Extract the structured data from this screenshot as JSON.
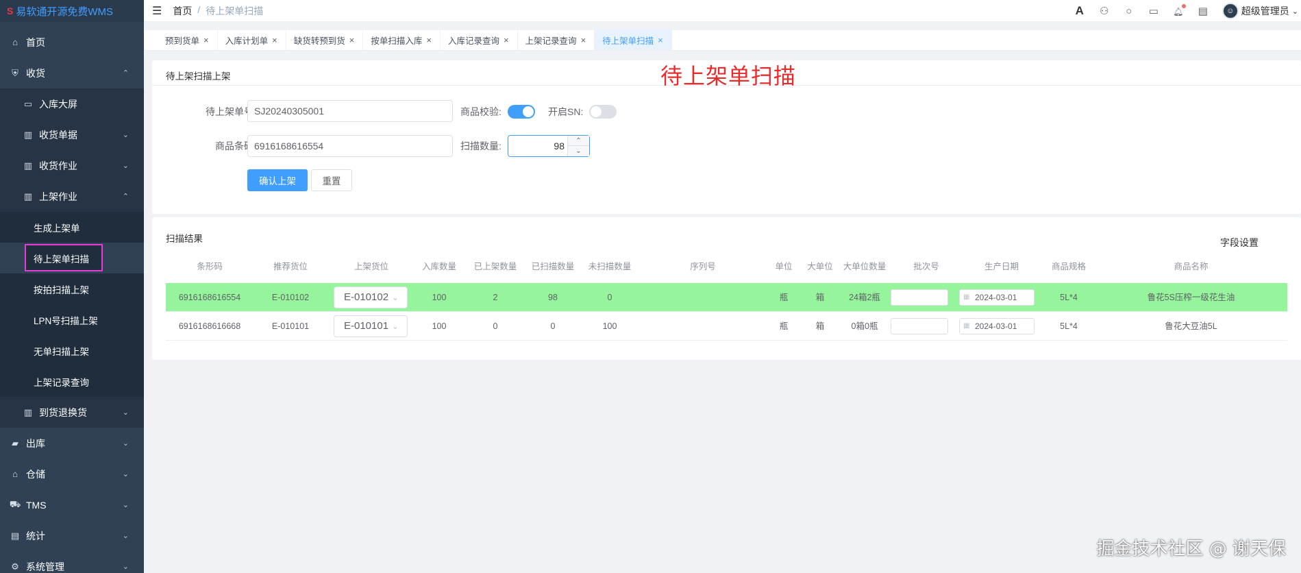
{
  "app": {
    "title": "易软通开源免费WMS",
    "logo_mark": "S"
  },
  "sidebar": {
    "items": [
      {
        "label": "首页",
        "icon": "home-icon",
        "glyph": "⌂"
      },
      {
        "label": "收货",
        "icon": "receive-icon",
        "glyph": "⛨",
        "arrow": "⌃"
      },
      {
        "label": "入库大屏",
        "icon": "monitor-icon",
        "glyph": "▭"
      },
      {
        "label": "收货单据",
        "icon": "doc-icon",
        "glyph": "▥",
        "arrow": "⌄"
      },
      {
        "label": "收货作业",
        "icon": "task-icon",
        "glyph": "▥",
        "arrow": "⌄"
      },
      {
        "label": "上架作业",
        "icon": "shelf-icon",
        "glyph": "▥",
        "arrow": "⌃"
      },
      {
        "label": "生成上架单"
      },
      {
        "label": "待上架单扫描"
      },
      {
        "label": "按拍扫描上架"
      },
      {
        "label": "LPN号扫描上架"
      },
      {
        "label": "无单扫描上架"
      },
      {
        "label": "上架记录查询"
      },
      {
        "label": "到货退换货",
        "icon": "return-icon",
        "glyph": "▥",
        "arrow": "⌄"
      },
      {
        "label": "出库",
        "icon": "outbound-icon",
        "glyph": "▰",
        "arrow": "⌄"
      },
      {
        "label": "仓储",
        "icon": "warehouse-icon",
        "glyph": "⌂",
        "arrow": "⌄"
      },
      {
        "label": "TMS",
        "icon": "truck-icon",
        "glyph": "⛟",
        "arrow": "⌄"
      },
      {
        "label": "统计",
        "icon": "stats-icon",
        "glyph": "▤",
        "arrow": "⌄"
      },
      {
        "label": "系统管理",
        "icon": "settings-icon",
        "glyph": "⚙",
        "arrow": "⌄"
      }
    ]
  },
  "header": {
    "hamburger": "☰",
    "breadcrumb": {
      "home": "首页",
      "sep": "/",
      "current": "待上架单扫描"
    },
    "icons": {
      "font": "A",
      "user": "⚇",
      "search": "○",
      "screen": "▭",
      "bell": "🔔︎",
      "doc": "▤"
    },
    "user_name": "超级管理员",
    "user_arrow": "⌄",
    "avatar_glyph": "☺"
  },
  "tabs": [
    {
      "label": "预到货单",
      "close": "×"
    },
    {
      "label": "入库计划单",
      "close": "×"
    },
    {
      "label": "缺货转预到货",
      "close": "×"
    },
    {
      "label": "按单扫描入库",
      "close": "×"
    },
    {
      "label": "入库记录查询",
      "close": "×"
    },
    {
      "label": "上架记录查询",
      "close": "×"
    },
    {
      "label": "待上架单扫描",
      "close": "×"
    }
  ],
  "form": {
    "card_title": "待上架扫描上架",
    "big_title": "待上架单扫描",
    "order_no_label": "待上架单号",
    "order_no_value": "SJ20240305001",
    "check_label": "商品校验:",
    "sn_label": "开启SN:",
    "barcode_label": "商品条码",
    "barcode_value": "6916168616554",
    "qty_label": "扫描数量:",
    "qty_value": "98",
    "step_up": "⌃",
    "step_down": "⌄",
    "confirm_label": "确认上架",
    "reset_label": "重置",
    "goods_check_on": true,
    "sn_on": false
  },
  "results": {
    "title": "扫描结果",
    "field_settings": "字段设置",
    "columns": [
      "条形码",
      "推荐货位",
      "上架货位",
      "入库数量",
      "已上架数量",
      "已扫描数量",
      "未扫描数量",
      "序列号",
      "单位",
      "大单位",
      "大单位数量",
      "批次号",
      "生产日期",
      "商品规格",
      "商品名称"
    ],
    "rows": [
      {
        "barcode": "6916168616554",
        "rec_loc": "E-010102",
        "shelf_loc": "E-010102",
        "in_qty": "100",
        "shelved": "2",
        "scanned": "98",
        "unscanned": "0",
        "serial": "",
        "unit": "瓶",
        "big_unit": "箱",
        "big_qty": "24箱2瓶",
        "batch": "",
        "prod_date": "2024-03-01",
        "spec": "5L*4",
        "name": "鲁花5S压榨一级花生油",
        "highlight": true
      },
      {
        "barcode": "6916168616668",
        "rec_loc": "E-010101",
        "shelf_loc": "E-010101",
        "in_qty": "100",
        "shelved": "0",
        "scanned": "0",
        "unscanned": "100",
        "serial": "",
        "unit": "瓶",
        "big_unit": "箱",
        "big_qty": "0箱0瓶",
        "batch": "",
        "prod_date": "2024-03-01",
        "spec": "5L*4",
        "name": "鲁花大豆油5L",
        "highlight": false
      }
    ],
    "select_chevron": "⌄",
    "calendar_glyph": "▦"
  },
  "watermark": "掘金技术社区 @ 谢天保",
  "colors": {
    "primary": "#409eff",
    "sidebar_bg": "#304156",
    "row_highlight": "#95f49c",
    "title_red": "#e52d2d",
    "active_border": "#e63bd4"
  }
}
